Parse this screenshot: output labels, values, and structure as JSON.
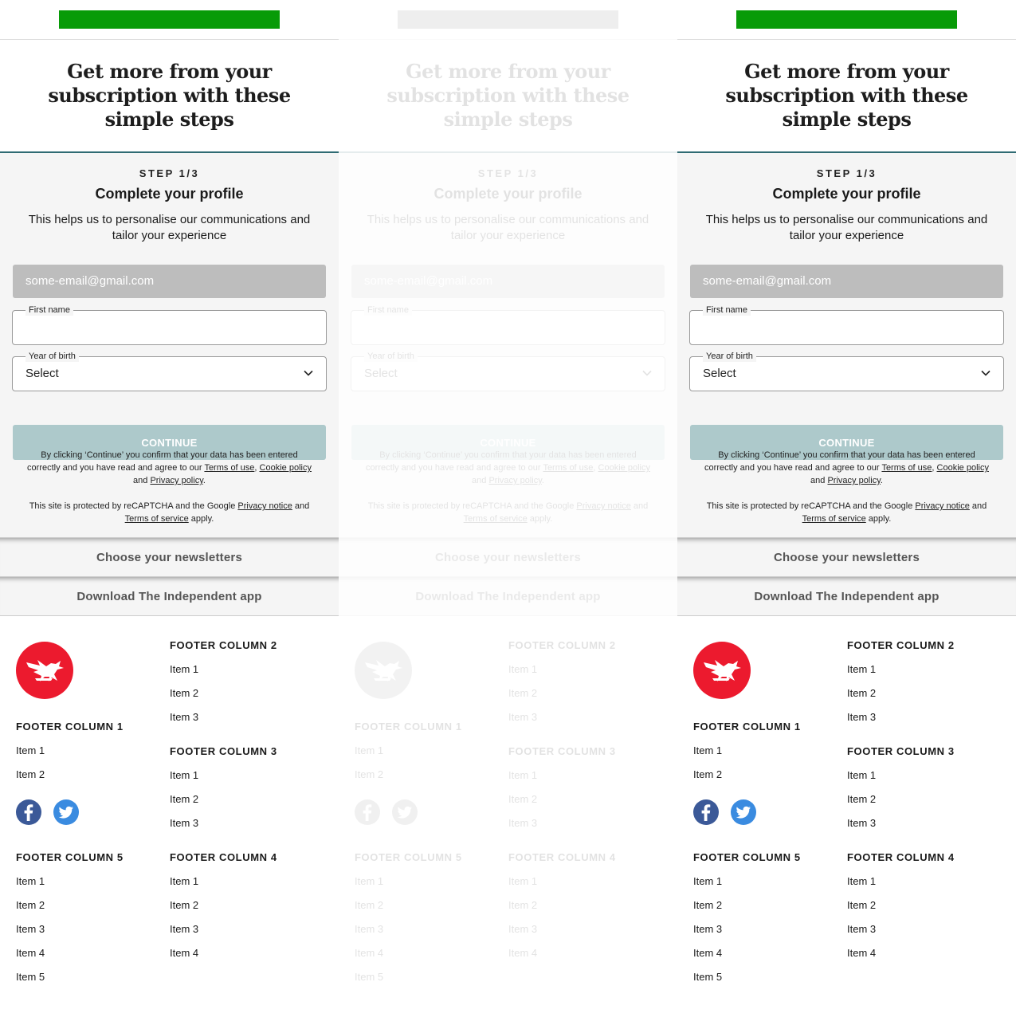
{
  "headline": "Get more from your subscription with these simple steps",
  "step": {
    "label": "STEP 1/3",
    "title": "Complete your profile",
    "description": "This helps us to personalise our communications and tailor your experience",
    "email_value": "some-email@gmail.com",
    "first_name_label": "First name",
    "year_label": "Year of birth",
    "year_value": "Select",
    "continue_label": "CONTINUE",
    "legal1": {
      "prefix": "By clicking ‘Continue’ you confirm that your data has been entered correctly and you have read and agree to our ",
      "terms": "Terms of use",
      "sep": ", ",
      "cookie": "Cookie policy",
      "and": " and ",
      "privacy": "Privacy policy",
      "end": "."
    },
    "legal2": {
      "prefix": "This site is protected by reCAPTCHA and the Google ",
      "privacy": "Privacy notice",
      "and": " and ",
      "terms": "Terms of service",
      "end": " apply."
    }
  },
  "accordions": {
    "newsletters": "Choose your newsletters",
    "app": "Download The Independent app"
  },
  "footer": {
    "col1": {
      "title": "FOOTER COLUMN 1",
      "items": [
        "Item 1",
        "Item 2"
      ]
    },
    "col2": {
      "title": "FOOTER COLUMN 2",
      "items": [
        "Item 1",
        "Item 2",
        "Item 3"
      ]
    },
    "col3": {
      "title": "FOOTER COLUMN 3",
      "items": [
        "Item 1",
        "Item 2",
        "Item 3"
      ]
    },
    "col4": {
      "title": "FOOTER COLUMN 4",
      "items": [
        "Item 1",
        "Item 2",
        "Item 3",
        "Item 4"
      ]
    },
    "col5": {
      "title": "FOOTER COLUMN 5",
      "items": [
        "Item 1",
        "Item 2",
        "Item 3",
        "Item 4",
        "Item 5"
      ]
    },
    "social": [
      "facebook-icon",
      "twitter-icon"
    ]
  },
  "colors": {
    "brand_green": "#089b08",
    "brand_red": "#ec1a2e",
    "continue_bg": "#adc9cb",
    "divider": "#2f6b73"
  }
}
